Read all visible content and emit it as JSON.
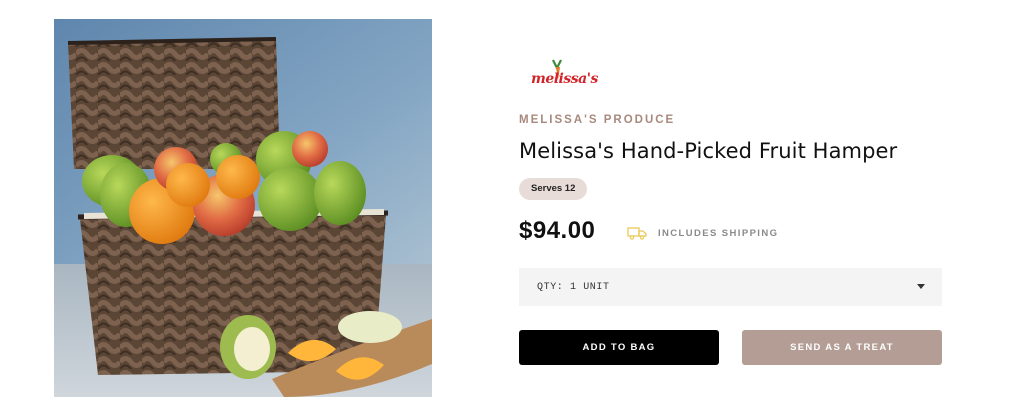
{
  "product": {
    "image_alt": "Wicker basket filled with apples, oranges and pears",
    "logo_text": "melissa's",
    "brand": "MELISSA'S PRODUCE",
    "title": "Melissa's Hand-Picked Fruit Hamper",
    "serves_badge": "Serves 12",
    "price": "$94.00",
    "shipping_icon": "truck-icon",
    "shipping_label": "INCLUDES SHIPPING"
  },
  "quantity": {
    "selected_label": "QTY: 1 UNIT",
    "icon": "chevron-down-icon"
  },
  "actions": {
    "add_to_bag": "ADD TO BAG",
    "send_as_treat": "SEND AS A TREAT"
  },
  "colors": {
    "brand_accent": "#a8897d",
    "treat_button": "#b39d94",
    "badge_bg": "#e8dcd8",
    "primary_button": "#000000",
    "logo_red": "#d2232a",
    "shipping_icon": "#e8c85a"
  }
}
